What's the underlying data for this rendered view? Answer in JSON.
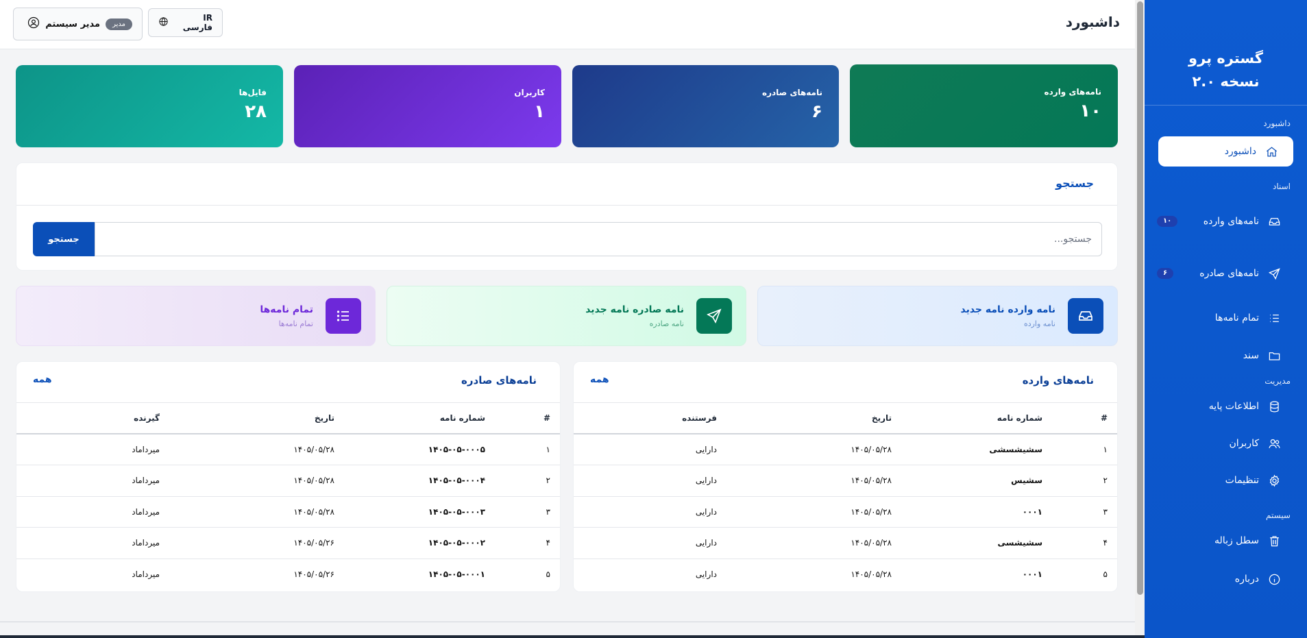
{
  "header": {
    "title": "داشبورد",
    "user_name": "مدیر سیستم",
    "role_badge": "مدیر",
    "language": "IR فارسی"
  },
  "stats": {
    "incoming": {
      "label": "نامه‌های وارده",
      "value": "۱۰"
    },
    "outgoing": {
      "label": "نامه‌های صادره",
      "value": "۶"
    },
    "users": {
      "label": "کاربران",
      "value": "۱"
    },
    "files": {
      "label": "فایل‌ها",
      "value": "۲۸"
    }
  },
  "search": {
    "title": "جستجو",
    "placeholder": "جستجو...",
    "button": "جستجو"
  },
  "quick_actions": {
    "new_incoming": {
      "title": "نامه وارده نامه جدید",
      "subtitle": "نامه وارده"
    },
    "new_outgoing": {
      "title": "نامه صادره نامه جدید",
      "subtitle": "نامه صادره"
    },
    "all_letters": {
      "title": "تمام نامه‌ها",
      "subtitle": "تمام نامه‌ها"
    }
  },
  "incoming_table": {
    "title": "نامه‌های وارده",
    "all_link": "همه",
    "columns": [
      "#",
      "شماره نامه",
      "تاریخ",
      "فرستنده"
    ],
    "rows": [
      [
        "۱",
        "سشیشسشی",
        "۱۴۰۵/۰۵/۲۸",
        "دارایی"
      ],
      [
        "۲",
        "سشیس",
        "۱۴۰۵/۰۵/۲۸",
        "دارایی"
      ],
      [
        "۳",
        "۰۰۰۱",
        "۱۴۰۵/۰۵/۲۸",
        "دارایی"
      ],
      [
        "۴",
        "سشیشسی",
        "۱۴۰۵/۰۵/۲۸",
        "دارایی"
      ],
      [
        "۵",
        "۰۰۰۱",
        "۱۴۰۵/۰۵/۲۸",
        "دارایی"
      ]
    ]
  },
  "outgoing_table": {
    "title": "نامه‌های صادره",
    "all_link": "همه",
    "columns": [
      "#",
      "شماره نامه",
      "تاریخ",
      "گیرنده"
    ],
    "rows": [
      [
        "۱",
        "۱۴۰۵-۰۵-۰۰۰۵",
        "۱۴۰۵/۰۵/۲۸",
        "میرداماد"
      ],
      [
        "۲",
        "۱۴۰۵-۰۵-۰۰۰۴",
        "۱۴۰۵/۰۵/۲۸",
        "میرداماد"
      ],
      [
        "۳",
        "۱۴۰۵-۰۵-۰۰۰۳",
        "۱۴۰۵/۰۵/۲۸",
        "میرداماد"
      ],
      [
        "۴",
        "۱۴۰۵-۰۵-۰۰۰۲",
        "۱۴۰۵/۰۵/۲۶",
        "میرداماد"
      ],
      [
        "۵",
        "۱۴۰۵-۰۵-۰۰۰۱",
        "۱۴۰۵/۰۵/۲۶",
        "میرداماد"
      ]
    ]
  },
  "sidebar": {
    "brand_name": "گستره پرو",
    "brand_version": "نسخه ۲.۰",
    "sections": {
      "dashboard": "داشبورد",
      "documents": "اسناد",
      "management": "مدیریت",
      "system": "سیستم"
    },
    "items": {
      "dashboard": {
        "label": "داشبورد",
        "icon": "home-icon"
      },
      "incoming": {
        "label": "نامه‌های وارده",
        "badge": "۱۰",
        "icon": "inbox-icon"
      },
      "outgoing": {
        "label": "نامه‌های صادره",
        "badge": "۶",
        "icon": "send-icon"
      },
      "all_letters": {
        "label": "تمام نامه‌ها",
        "icon": "list-icon"
      },
      "document": {
        "label": "سند",
        "icon": "folder-icon"
      },
      "base_info": {
        "label": "اطلاعات پایه",
        "icon": "database-icon"
      },
      "users": {
        "label": "کاربران",
        "icon": "users-icon"
      },
      "settings": {
        "label": "تنظیمات",
        "icon": "gear-icon"
      },
      "trash": {
        "label": "سطل زباله",
        "icon": "trash-icon"
      },
      "about": {
        "label": "درباره",
        "icon": "info-icon"
      }
    }
  },
  "colors": {
    "sidebar": "#0b55c9",
    "primary": "#0b4fb8",
    "incoming_card": "#047857",
    "outgoing_card": "#1e3a8a",
    "users_card": "#6d28d9",
    "files_card": "#0d9488"
  }
}
